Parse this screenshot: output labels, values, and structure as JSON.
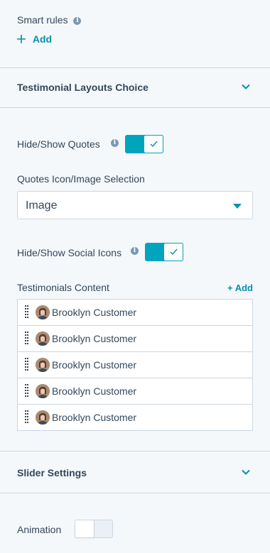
{
  "smart_rules": {
    "label": "Smart rules",
    "add_label": "Add",
    "plus": "+"
  },
  "layouts_section": {
    "title": "Testimonial Layouts Choice"
  },
  "hide_show_quotes": {
    "label": "Hide/Show Quotes",
    "enabled": true
  },
  "quotes_icon_selection": {
    "label": "Quotes Icon/Image Selection",
    "value": "Image"
  },
  "hide_show_social_icons": {
    "label": "Hide/Show Social Icons",
    "enabled": true
  },
  "testimonials_content": {
    "label": "Testimonials Content",
    "add_label": "+ Add",
    "items": [
      {
        "name": "Brooklyn Customer"
      },
      {
        "name": "Brooklyn Customer"
      },
      {
        "name": "Brooklyn Customer"
      },
      {
        "name": "Brooklyn Customer"
      },
      {
        "name": "Brooklyn Customer"
      }
    ]
  },
  "slider_settings": {
    "title": "Slider Settings"
  },
  "animation": {
    "label": "Animation",
    "enabled": false
  },
  "colors": {
    "accent": "#00a4bd",
    "link": "#0091ae",
    "text": "#33475b",
    "border": "#cbd6e2",
    "background": "#f5f8fa"
  }
}
